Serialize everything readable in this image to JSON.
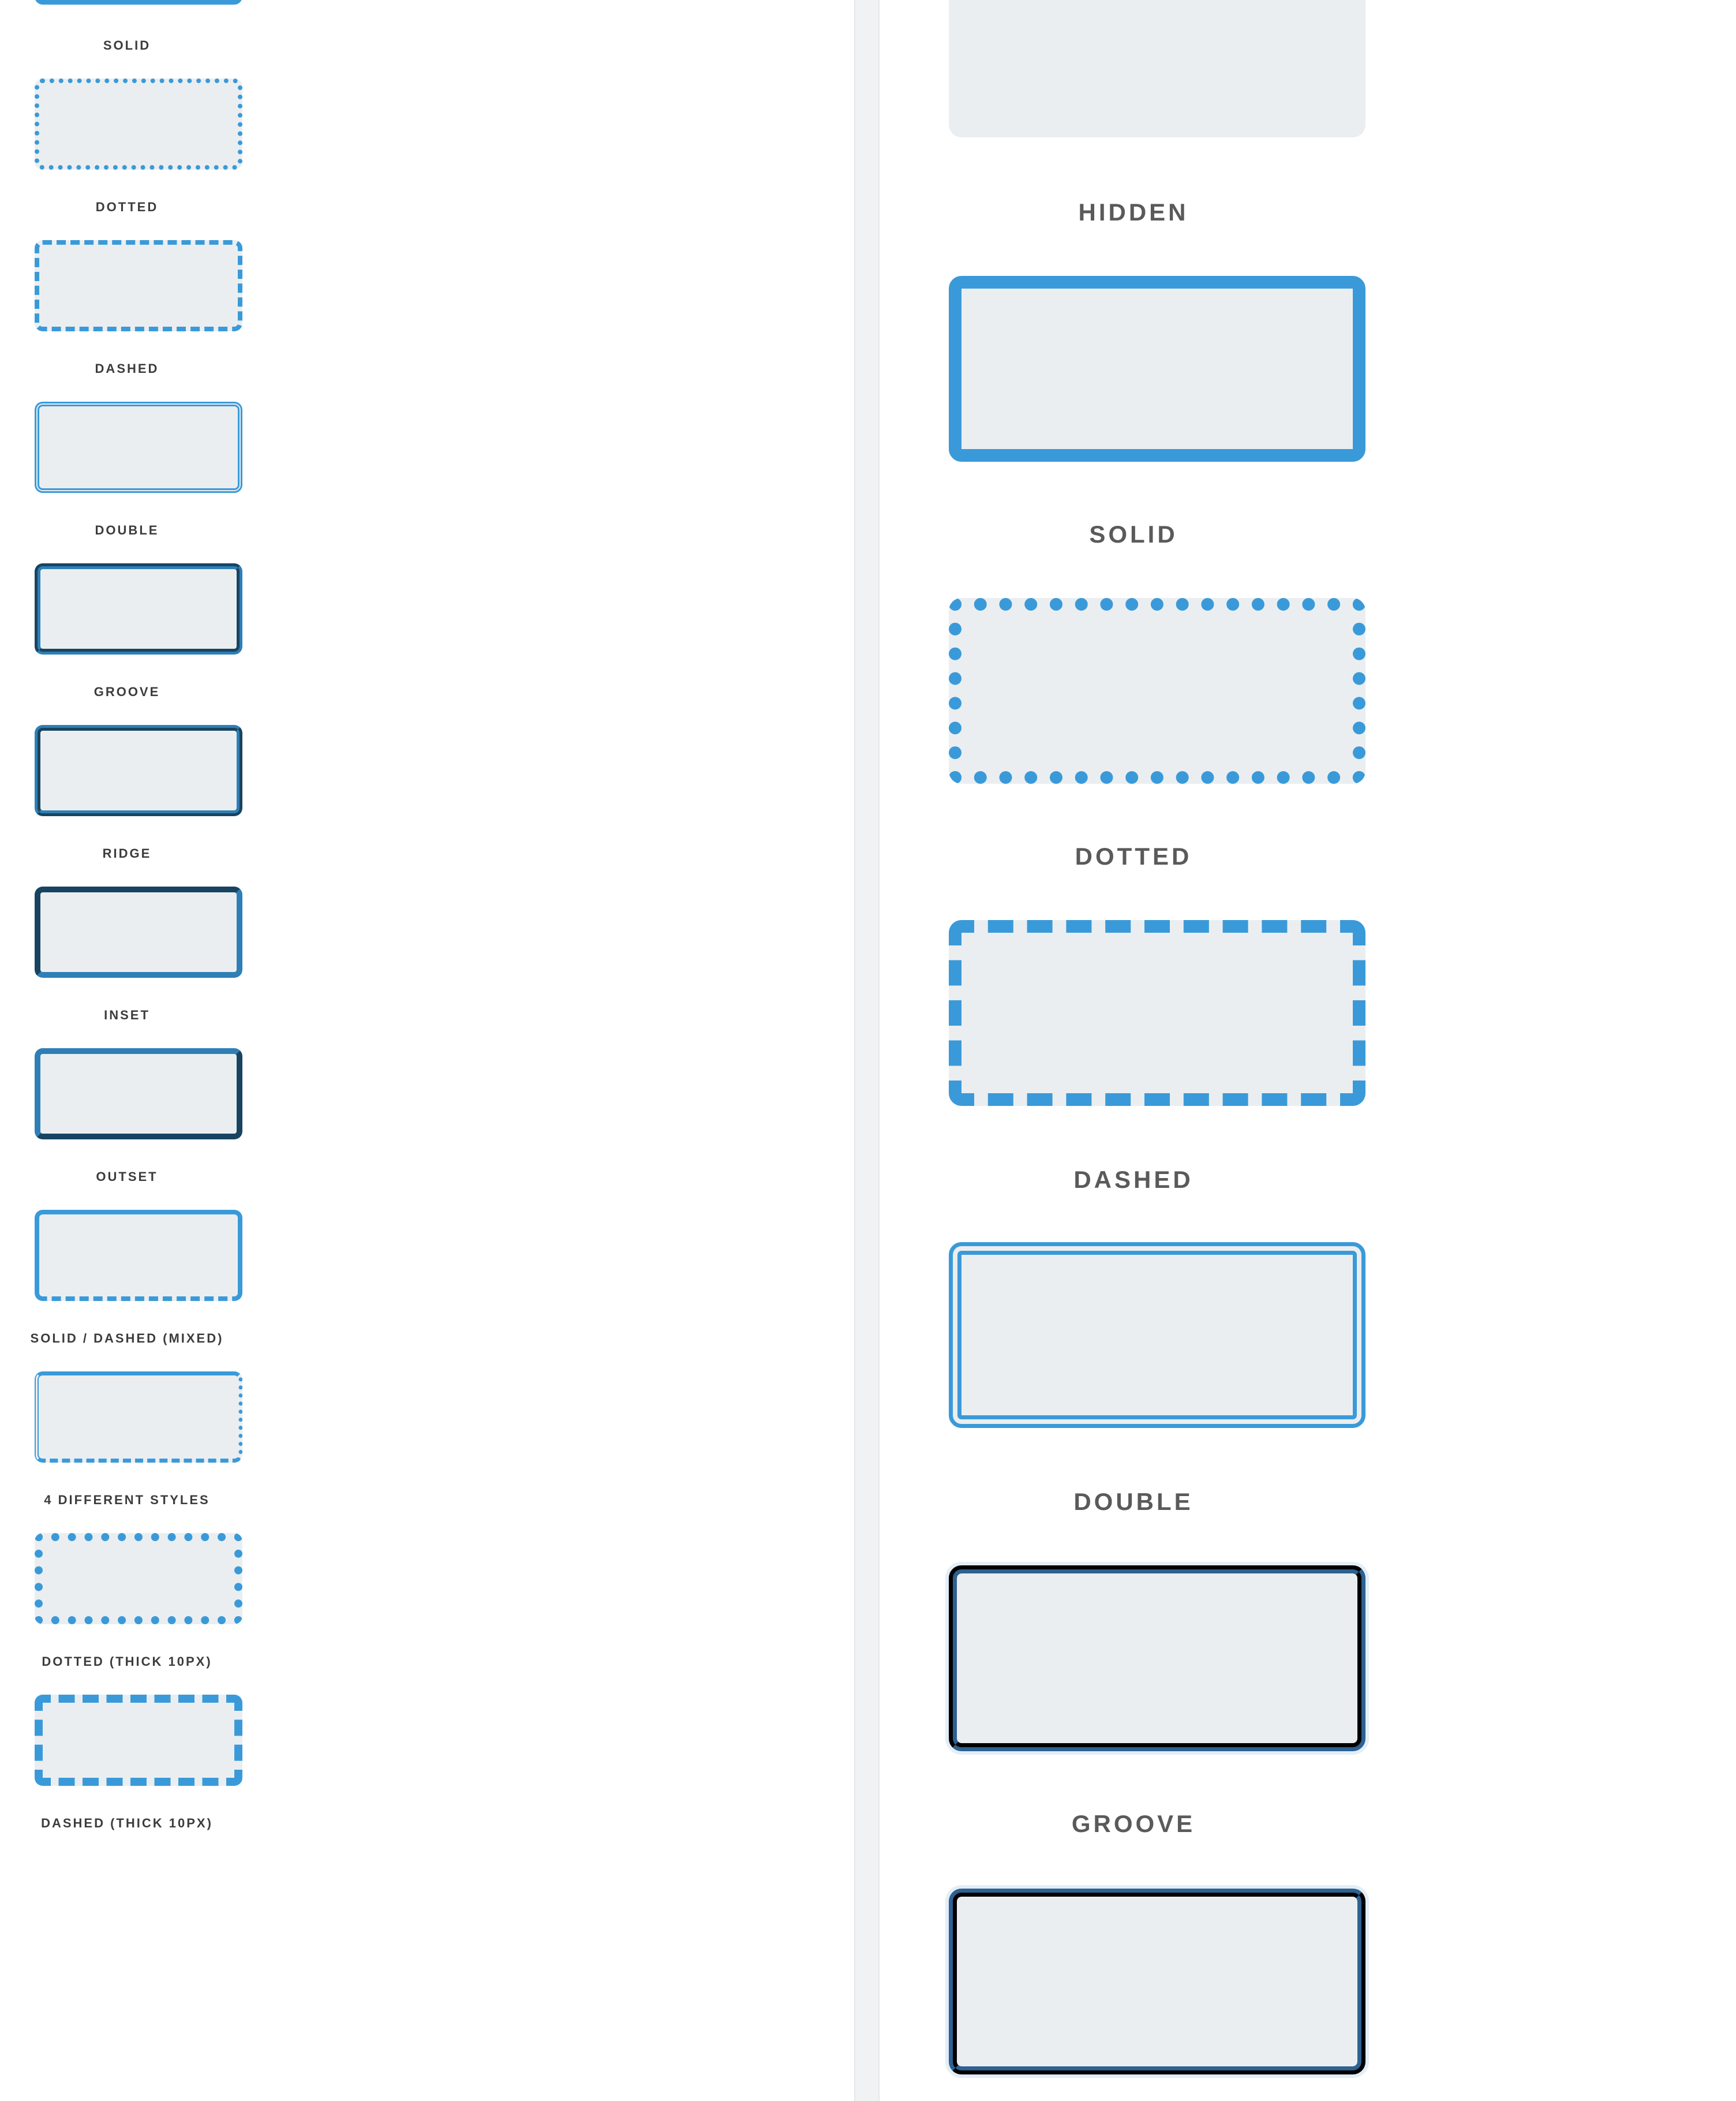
{
  "left_panel": {
    "items": [
      {
        "label": "SOLID"
      },
      {
        "label": "DOTTED"
      },
      {
        "label": "DASHED"
      },
      {
        "label": "DOUBLE"
      },
      {
        "label": "GROOVE"
      },
      {
        "label": "RIDGE"
      },
      {
        "label": "INSET"
      },
      {
        "label": "OUTSET"
      },
      {
        "label": "SOLID / DASHED (MIXED)"
      },
      {
        "label": "4 DIFFERENT STYLES"
      },
      {
        "label": "DOTTED (THICK 10PX)"
      },
      {
        "label": "DASHED (THICK 10PX)"
      }
    ]
  },
  "right_panel": {
    "items": [
      {
        "label": "HIDDEN"
      },
      {
        "label": "SOLID"
      },
      {
        "label": "DOTTED"
      },
      {
        "label": "DASHED"
      },
      {
        "label": "DOUBLE"
      },
      {
        "label": "GROOVE"
      }
    ]
  },
  "colors": {
    "accent": "#3a9ad9",
    "dark_border": "#13293d",
    "box_fill": "#ebeef0",
    "divider": "#f1f2f3",
    "label_text": "#5a5a5a"
  }
}
